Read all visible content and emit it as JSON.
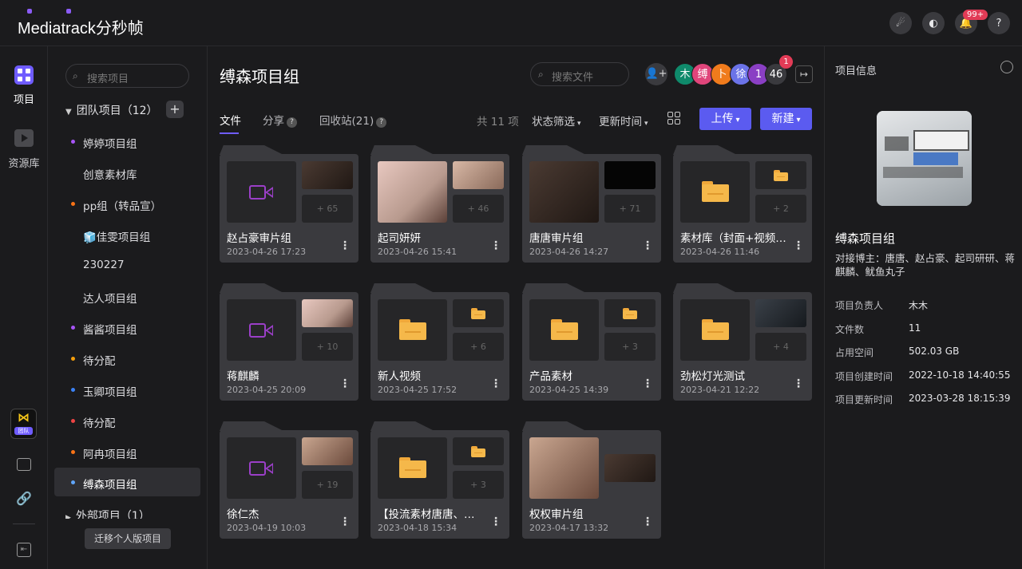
{
  "app": {
    "logo_text": "Mediatrack分秒帧",
    "notif_badge": "99+"
  },
  "rail": {
    "items": [
      {
        "label": "项目"
      },
      {
        "label": "资源库"
      }
    ],
    "team_badge": "团队"
  },
  "sidebar": {
    "search_placeholder": "搜索项目",
    "team_group": "团队项目（12）",
    "items": [
      {
        "label": "婷婷项目组",
        "dot": "#a855f7"
      },
      {
        "label": "创意素材库",
        "dot": ""
      },
      {
        "label": "pp组（转品宣）",
        "dot": "#f97316"
      },
      {
        "label": "🧊佳雯项目组",
        "dot": ""
      },
      {
        "label": "230227",
        "dot": ""
      },
      {
        "label": "达人项目组",
        "dot": ""
      },
      {
        "label": "酱酱项目组",
        "dot": "#a855f7"
      },
      {
        "label": "待分配",
        "dot": "#f59e0b"
      },
      {
        "label": "玉卿项目组",
        "dot": "#3b82f6"
      },
      {
        "label": "待分配",
        "dot": "#ef4444"
      },
      {
        "label": "阿冉项目组",
        "dot": "#f97316"
      },
      {
        "label": "缚森项目组",
        "dot": "#60a5fa"
      }
    ],
    "external_group": "外部项目（1）",
    "migrate_label": "迁移个人版项目"
  },
  "main": {
    "title": "缚森项目组",
    "file_search_placeholder": "搜索文件",
    "members": [
      {
        "label": "木",
        "color": "#0f8a6b"
      },
      {
        "label": "缚",
        "color": "#e0457b"
      },
      {
        "label": "卜",
        "color": "#f07b1c"
      },
      {
        "label": "徐",
        "color": "#6b73e8"
      },
      {
        "label": "1",
        "color": "#8a3fc4"
      },
      {
        "label": "46",
        "color": "#3a3a3e"
      }
    ],
    "member_badge": "1",
    "tabs": [
      {
        "label": "文件"
      },
      {
        "label": "分享"
      },
      {
        "label": "回收站(21)"
      }
    ],
    "count_text": "共 11 项",
    "filter_label": "状态筛选",
    "sort_label": "更新时间",
    "upload_label": "上传",
    "new_label": "新建",
    "cards": [
      {
        "name": "赵占豪审片组",
        "date": "2023-04-26 17:23",
        "more": "+ 65",
        "big": "video",
        "sm1": "photo"
      },
      {
        "name": "起司妍妍",
        "date": "2023-04-26 15:41",
        "more": "+ 46",
        "big": "photo",
        "sm1": "photo"
      },
      {
        "name": "唐唐审片组",
        "date": "2023-04-26 14:27",
        "more": "+ 71",
        "big": "photo",
        "sm1": "dark"
      },
      {
        "name": "素材库（封面+视频…",
        "date": "2023-04-26 11:46",
        "more": "+ 2",
        "big": "folder",
        "sm1": "folder"
      },
      {
        "name": "蒋麒麟",
        "date": "2023-04-25 20:09",
        "more": "+ 10",
        "big": "video",
        "sm1": "photo"
      },
      {
        "name": "新人视频",
        "date": "2023-04-25 17:52",
        "more": "+ 6",
        "big": "folder",
        "sm1": "folder"
      },
      {
        "name": "产品素材",
        "date": "2023-04-25 14:39",
        "more": "+ 3",
        "big": "folder",
        "sm1": "folder"
      },
      {
        "name": "劲松灯光测试",
        "date": "2023-04-21 12:22",
        "more": "+ 4",
        "big": "folder",
        "sm1": "photo"
      },
      {
        "name": "徐仁杰",
        "date": "2023-04-19 10:03",
        "more": "+ 19",
        "big": "video",
        "sm1": "photo"
      },
      {
        "name": "【投流素材唐唐、…",
        "date": "2023-04-18 15:34",
        "more": "+ 3",
        "big": "folder",
        "sm1": "folder"
      },
      {
        "name": "权权审片组",
        "date": "2023-04-17 13:32",
        "more": "",
        "big": "photo",
        "sm1": "photo"
      }
    ]
  },
  "panel": {
    "title": "项目信息",
    "project_name": "缚森项目组",
    "description": "对接博主：唐唐、赵占豪、起司研研、蒋麒麟、鱿鱼丸子",
    "fields": [
      {
        "key": "项目负责人",
        "value": "木木"
      },
      {
        "key": "文件数",
        "value": "11"
      },
      {
        "key": "占用空间",
        "value": "502.03 GB"
      },
      {
        "key": "项目创建时间",
        "value": "2022-10-18 14:40:55"
      },
      {
        "key": "项目更新时间",
        "value": "2023-03-28 18:15:39"
      }
    ]
  }
}
